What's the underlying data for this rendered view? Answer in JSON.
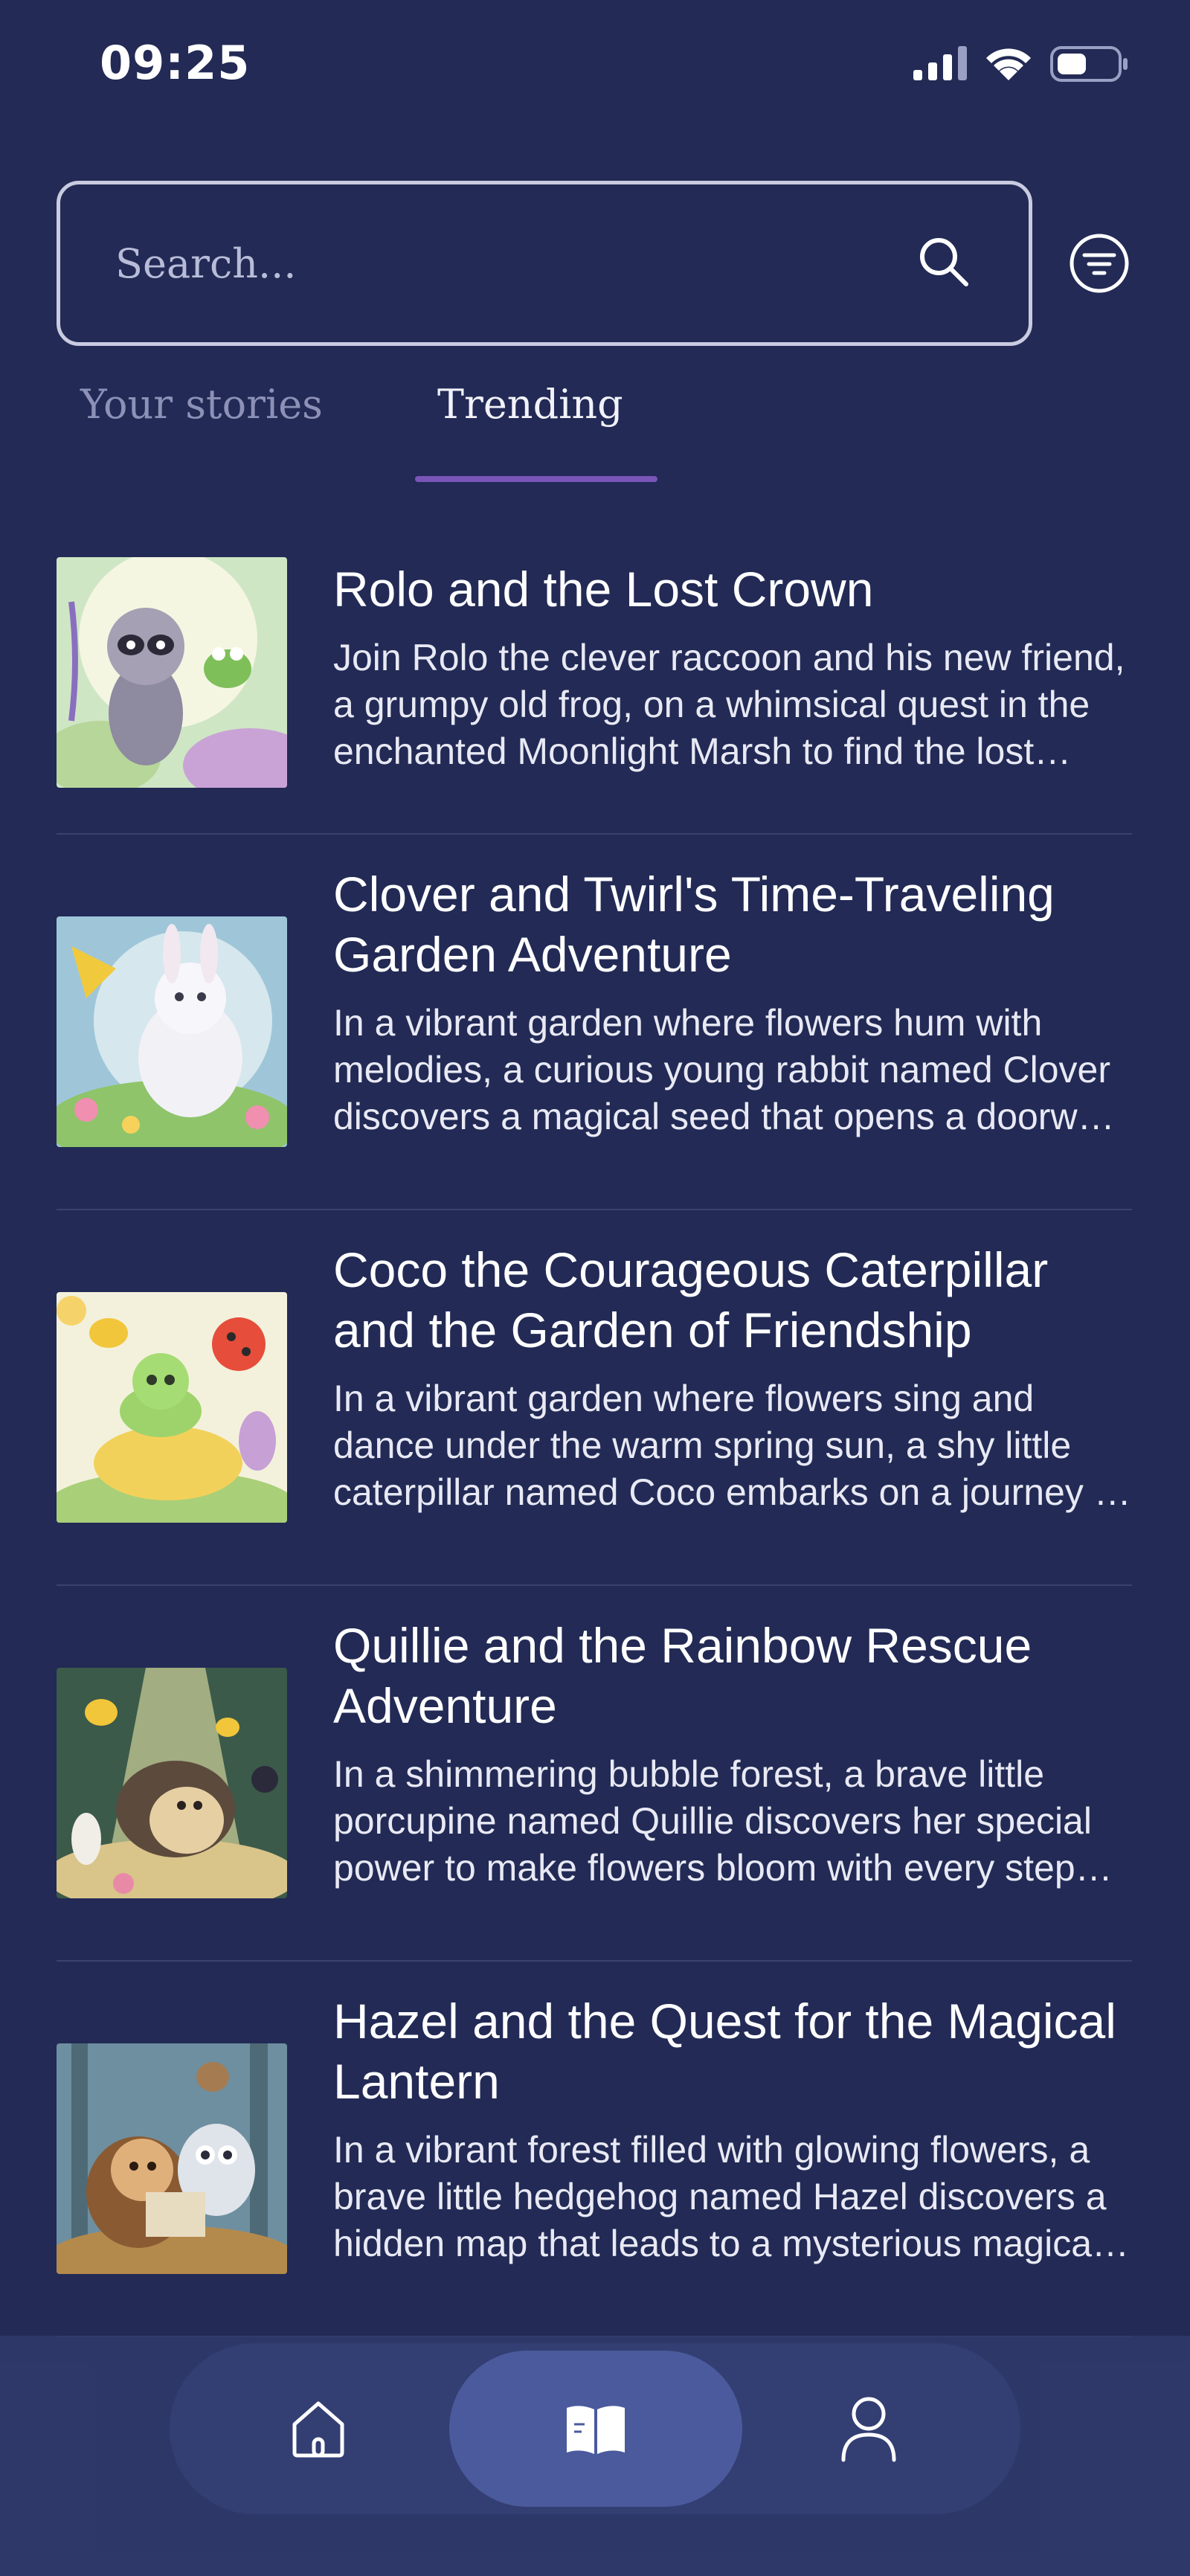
{
  "status_bar": {
    "time": "09:25"
  },
  "search": {
    "placeholder": "Search..."
  },
  "tabs": [
    {
      "label": "Your stories",
      "active": false
    },
    {
      "label": "Trending",
      "active": true
    }
  ],
  "stories": [
    {
      "title": "Rolo and the Lost Crown",
      "description": "Join Rolo the clever raccoon and his new friend, a grumpy old frog, on a whimsical quest in the enchanted Moonlight Marsh to find the lost crown."
    },
    {
      "title": "Clover and Twirl's Time-Traveling Garden Adventure",
      "description": "In a vibrant garden where flowers hum with melodies, a curious young rabbit named Clover discovers a magical seed that opens a doorway through time."
    },
    {
      "title": "Coco the Courageous Caterpillar and the Garden of Friendship",
      "description": "In a vibrant garden where flowers sing and dance under the warm spring sun, a shy little caterpillar named Coco embarks on a journey to find true friendship."
    },
    {
      "title": "Quillie and the Rainbow Rescue Adventure",
      "description": "In a shimmering bubble forest, a brave little porcupine named Quillie discovers her special power to make flowers bloom with every step she takes."
    },
    {
      "title": "Hazel and the Quest for the Magical Lantern",
      "description": "In a vibrant forest filled with glowing flowers, a brave little hedgehog named Hazel discovers a hidden map that leads to a mysterious magical lantern."
    }
  ],
  "icons": {
    "status": [
      "signal-icon",
      "wifi-icon",
      "battery-icon"
    ],
    "search": "search-icon",
    "filter": "filter-icon",
    "nav": [
      "home-icon",
      "book-icon",
      "user-icon"
    ]
  },
  "colors": {
    "background": "#222a55",
    "tab_active_underline": "#7a55b8",
    "nav_active": "#4a5a9c"
  }
}
